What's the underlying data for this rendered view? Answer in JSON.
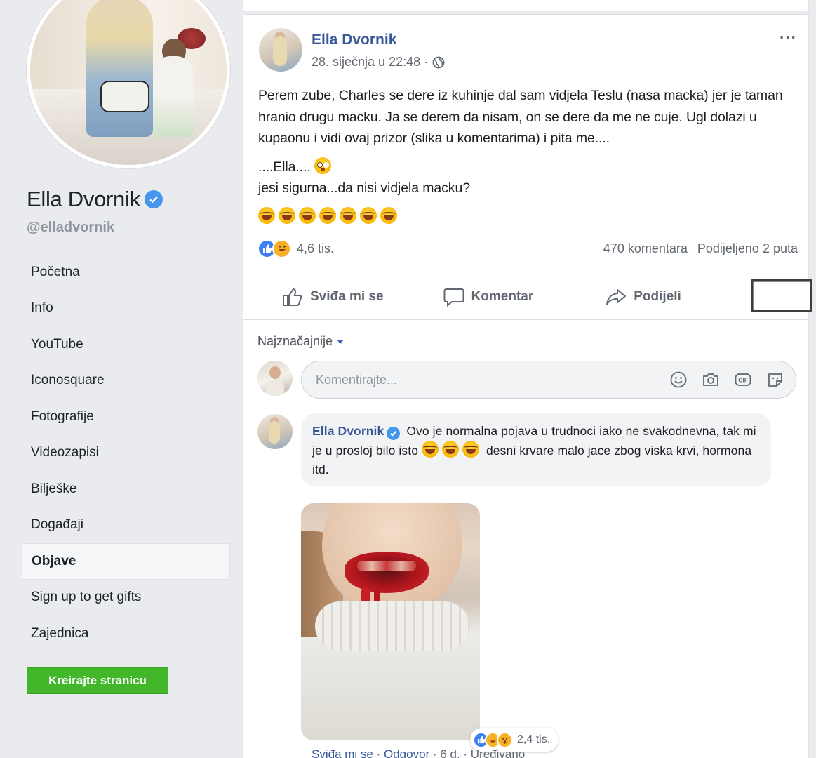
{
  "profile": {
    "name": "Ella Dvornik",
    "handle": "@elladvornik"
  },
  "nav": {
    "items": [
      {
        "label": "Početna"
      },
      {
        "label": "Info"
      },
      {
        "label": "YouTube"
      },
      {
        "label": "Iconosquare"
      },
      {
        "label": "Fotografije"
      },
      {
        "label": "Videozapisi"
      },
      {
        "label": "Bilješke"
      },
      {
        "label": "Događaji"
      },
      {
        "label": "Objave"
      },
      {
        "label": "Sign up to get gifts"
      },
      {
        "label": "Zajednica"
      }
    ],
    "active": "Objave",
    "create_page": "Kreirajte stranicu"
  },
  "post": {
    "author": "Ella Dvornik",
    "timestamp": "28. siječnja u 22:48 ·",
    "more": "···",
    "paragraph1": "Perem zube, Charles se dere iz kuhinje dal sam vidjela Teslu (nasa macka) jer je taman hranio drugu macku. Ja se derem da nisam, on se dere da me ne cuje. Ugl dolazi u kupaonu i vidi ovaj prizor (slika u komentarima) i pita me....",
    "line2": "....Ella....",
    "line3": "jesi sigurna...da nisi vidjela macku?",
    "reaction_count": "4,6 tis.",
    "comments_count": "470 komentara",
    "shares": "Podijeljeno 2 puta",
    "actions": {
      "like": "Sviđa mi se",
      "comment": "Komentar",
      "share": "Podijeli"
    }
  },
  "comments": {
    "sort_label": "Najznačajnije",
    "input_placeholder": "Komentirajte...",
    "items": [
      {
        "author": "Ella Dvornik",
        "text_part1": "Ovo je normalna pojava u trudnoci iako ne svakodnevna, tak mi je u prosloj bilo isto",
        "text_part2": "desni krvare malo jace zbog viska krvi, hormona itd.",
        "reaction_count": "2,4 tis.",
        "like": "Sviđa mi se",
        "reply": "Odgovor",
        "age": "6 d.",
        "edited": "Uređivano"
      }
    ]
  },
  "colors": {
    "link": "#385898",
    "like_blue": "#3b7ff1",
    "create_green": "#42b72a",
    "background": "#e9ebee"
  }
}
